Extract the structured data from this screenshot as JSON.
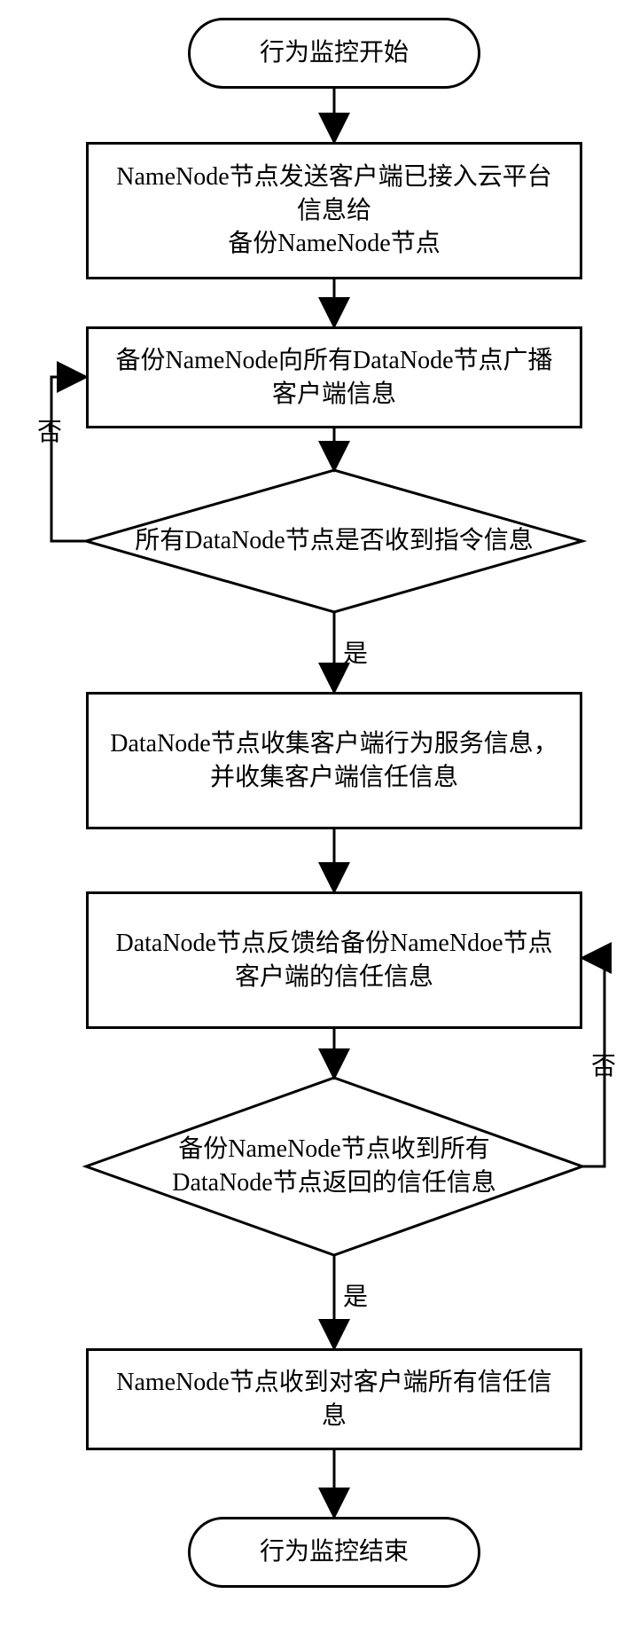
{
  "nodes": {
    "start": "行为监控开始",
    "step1": "NameNode节点发送客户端已接入云平台信息给\n备份NameNode节点",
    "step2": "备份NameNode向所有DataNode节点广播客户端信息",
    "dec1": "所有DataNode节点是否收到指令信息",
    "step3": "DataNode节点收集客户端行为服务信息，并收集客户端信任信息",
    "step4": "DataNode节点反馈给备份NameNdoe节点客户端的信任信息",
    "dec2": "备份NameNode节点收到所有DataNode节点返回的信任信息",
    "step5": "NameNode节点收到对客户端所有信任信息",
    "end": "行为监控结束"
  },
  "labels": {
    "no1": "否",
    "yes1": "是",
    "no2": "否",
    "yes2": "是"
  }
}
